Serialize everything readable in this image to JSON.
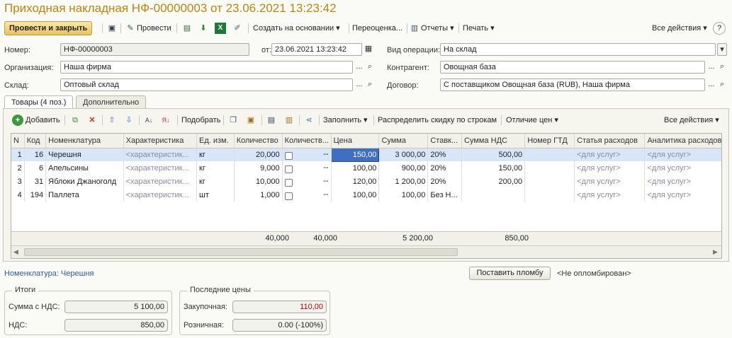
{
  "window_title": "Приходная накладная НФ-00000003 от 23.06.2021 13:23:42",
  "toolbar": {
    "post_close": "Провести и закрыть",
    "post": "Провести",
    "create_based": "Создать на основании ▾",
    "reprice": "Переоценка...",
    "reports": "Отчеты ▾",
    "print": "Печать ▾",
    "all_actions": "Все действия ▾",
    "help": "?"
  },
  "form": {
    "number_label": "Номер:",
    "number_value": "НФ-00000003",
    "date_label": "от:",
    "date_value": "23.06.2021 13:23:42",
    "operation_label": "Вид операции:",
    "operation_value": "На склад",
    "org_label": "Организация:",
    "org_value": "Наша фирма",
    "contractor_label": "Контрагент:",
    "contractor_value": "Овощная база",
    "warehouse_label": "Склад:",
    "warehouse_value": "Оптовый склад",
    "contract_label": "Договор:",
    "contract_value": "С поставщиком Овощная база (RUB), Наша фирма"
  },
  "tabs": [
    "Товары (4 поз.)",
    "Дополнительно"
  ],
  "table_toolbar": {
    "add": "Добавить",
    "pick": "Подобрать",
    "fill": "Заполнить ▾",
    "distribute": "Распределить скидку по строкам",
    "price_diff": "Отличие цен ▾",
    "all_actions": "Все действия ▾"
  },
  "columns": [
    "N",
    "Код",
    "Номенклатура",
    "Характеристика",
    "Ед. изм.",
    "Количество",
    "Количеств...",
    "Цена",
    "Сумма",
    "Ставк...",
    "Сумма НДС",
    "Номер ГТД",
    "Статья расходов",
    "Аналитика расходов"
  ],
  "rows": [
    {
      "n": "1",
      "code": "16",
      "name": "Черешня",
      "char": "<характеристик...",
      "unit": "кг",
      "qty": "20,000",
      "qty2": "--",
      "price": "150,00",
      "sum": "3 000,00",
      "rate": "20%",
      "vat": "500,00",
      "gtd": "",
      "expense": "<для услуг>",
      "analytics": "<для услуг>"
    },
    {
      "n": "2",
      "code": "6",
      "name": "Апельсины",
      "char": "<характеристик...",
      "unit": "кг",
      "qty": "9,000",
      "qty2": "--",
      "price": "100,00",
      "sum": "900,00",
      "rate": "20%",
      "vat": "150,00",
      "gtd": "",
      "expense": "<для услуг>",
      "analytics": "<для услуг>"
    },
    {
      "n": "3",
      "code": "31",
      "name": "Яблоки Джаноголд",
      "char": "<характеристик...",
      "unit": "кг",
      "qty": "10,000",
      "qty2": "--",
      "price": "120,00",
      "sum": "1 200,00",
      "rate": "20%",
      "vat": "200,00",
      "gtd": "",
      "expense": "<для услуг>",
      "analytics": "<для услуг>"
    },
    {
      "n": "4",
      "code": "194",
      "name": "Паллета",
      "char": "<характеристик...",
      "unit": "шт",
      "qty": "1,000",
      "qty2": "--",
      "price": "100,00",
      "sum": "100,00",
      "rate": "Без Н...",
      "vat": "",
      "gtd": "",
      "expense": "<для услуг>",
      "analytics": "<для услуг>"
    }
  ],
  "totals": {
    "qty": "40,000",
    "qty2": "40,000",
    "sum": "5 200,00",
    "vat": "850,00"
  },
  "bottom": {
    "nomenclature_label": "Номенклатура: Черешня",
    "seal_button": "Поставить пломбу",
    "seal_status": "<Не опломбирован>"
  },
  "itogi": {
    "title": "Итоги",
    "sum_label": "Сумма с НДС:",
    "sum_value": "5 100,00",
    "vat_label": "НДС:",
    "vat_value": "850,00"
  },
  "last_prices": {
    "title": "Последние цены",
    "purchase_label": "Закупочная:",
    "purchase_value": "110,00",
    "retail_label": "Розничная:",
    "retail_value": "0.00 (-100%)"
  },
  "colors": {
    "accent": "#b8860b",
    "selection": "#d7e6f9",
    "active_cell": "#3f6ec2",
    "red_value": "#c00000"
  }
}
